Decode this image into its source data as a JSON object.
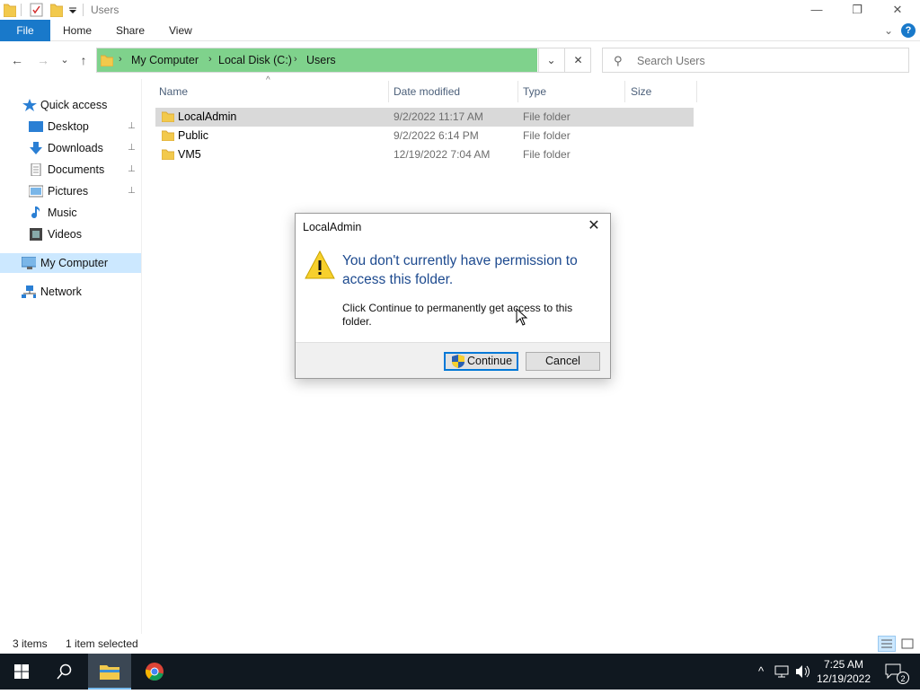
{
  "window": {
    "title": "Users",
    "controls": {
      "minimize": "—",
      "restore": "❐",
      "close": "✕"
    }
  },
  "ribbon": {
    "tabs": [
      "File",
      "Home",
      "Share",
      "View"
    ],
    "expand_icon": "⌄",
    "help_icon": "?"
  },
  "nav": {
    "back": "←",
    "forward": "→",
    "recent": "⌄",
    "up": "↑"
  },
  "address": {
    "breadcrumbs": [
      "My Computer",
      "Local Disk (C:)",
      "Users"
    ],
    "separator": "›",
    "dropdown_icon": "⌄",
    "clear_icon": "✕"
  },
  "search": {
    "placeholder": "Search Users",
    "icon": "⚲"
  },
  "sidebar": {
    "items": [
      {
        "label": "Quick access",
        "icon": "star-icon",
        "pinned": false
      },
      {
        "label": "Desktop",
        "icon": "desktop-icon",
        "pinned": true
      },
      {
        "label": "Downloads",
        "icon": "download-icon",
        "pinned": true
      },
      {
        "label": "Documents",
        "icon": "documents-icon",
        "pinned": true
      },
      {
        "label": "Pictures",
        "icon": "pictures-icon",
        "pinned": true
      },
      {
        "label": "Music",
        "icon": "music-icon",
        "pinned": false
      },
      {
        "label": "Videos",
        "icon": "videos-icon",
        "pinned": false
      },
      {
        "label": "My Computer",
        "icon": "computer-icon",
        "pinned": false,
        "selected": true
      },
      {
        "label": "Network",
        "icon": "network-icon",
        "pinned": false
      }
    ],
    "pin_glyph": "📌"
  },
  "file_list": {
    "columns": [
      "Name",
      "Date modified",
      "Type",
      "Size"
    ],
    "sort_indicator": "^",
    "rows": [
      {
        "name": "LocalAdmin",
        "date": "9/2/2022 11:17 AM",
        "type": "File folder",
        "size": "",
        "selected": true
      },
      {
        "name": "Public",
        "date": "9/2/2022 6:14 PM",
        "type": "File folder",
        "size": "",
        "selected": false
      },
      {
        "name": "VM5",
        "date": "12/19/2022 7:04 AM",
        "type": "File folder",
        "size": "",
        "selected": false
      }
    ]
  },
  "dialog": {
    "title": "LocalAdmin",
    "headline": "You don't currently have permission to access this folder.",
    "body": "Click Continue to permanently get access to this folder.",
    "continue_label": "Continue",
    "cancel_label": "Cancel",
    "close_icon": "✕"
  },
  "status": {
    "item_count": "3 items",
    "selection": "1 item selected"
  },
  "taskbar": {
    "time": "7:25 AM",
    "date": "12/19/2022",
    "notification_count": "2",
    "tray_chevron": "^",
    "colors": {
      "background": "#101820",
      "active_underline": "#76b9ed"
    }
  },
  "colors": {
    "accent": "#1979ca",
    "address_highlight": "#7fd28c",
    "selection": "#cce8ff",
    "row_selected": "#d9d9d9",
    "dialog_headline": "#1d4a8f"
  }
}
